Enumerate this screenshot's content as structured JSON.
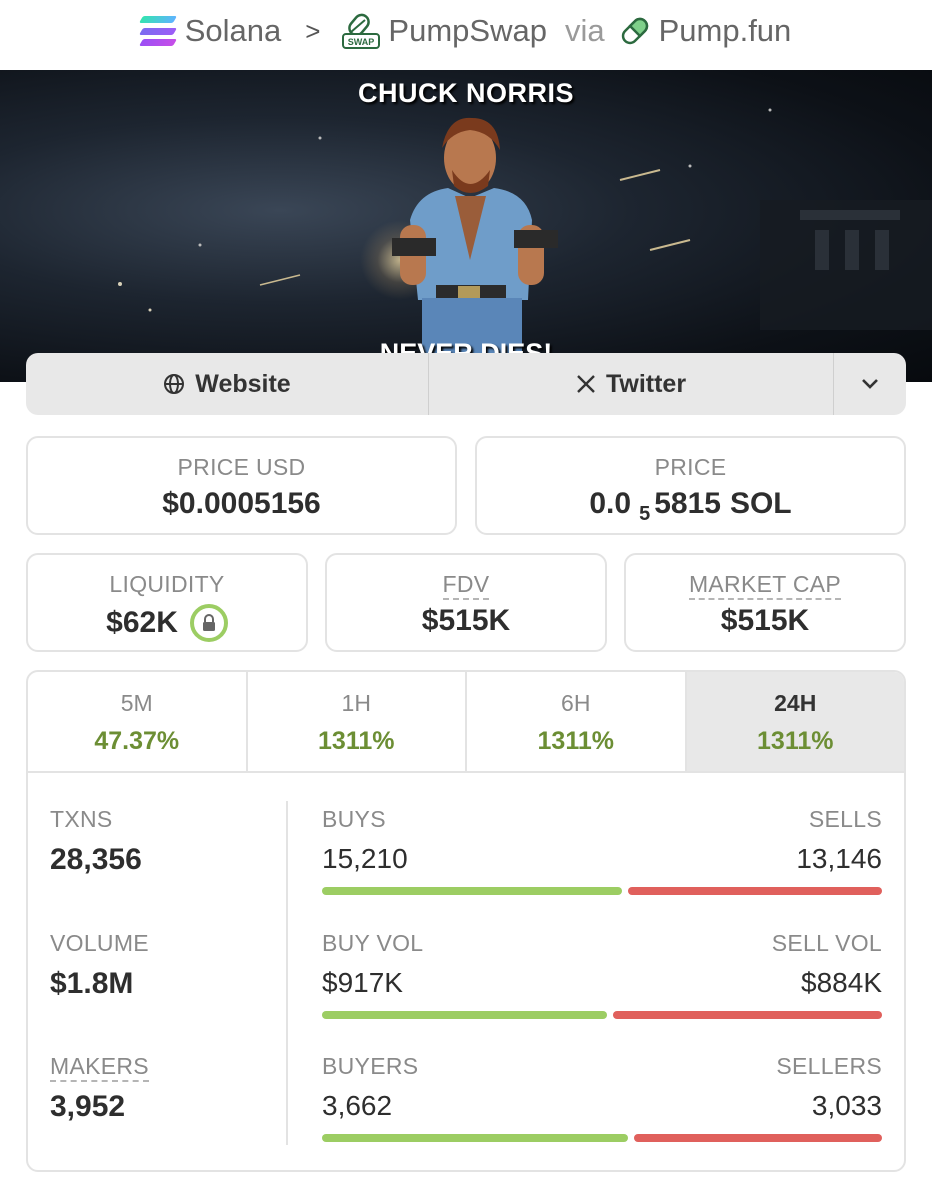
{
  "breadcrumb": {
    "chain": "Solana",
    "separator": ">",
    "dex": "PumpSwap",
    "dex_icon_text": "SWAP",
    "via": "via",
    "launchpad": "Pump.fun"
  },
  "banner": {
    "top_text": "CHUCK NORRIS",
    "bottom_text": "NEVER DIES!"
  },
  "links": {
    "website": "Website",
    "twitter": "Twitter"
  },
  "price": {
    "usd_label": "PRICE USD",
    "usd_value": "$0.0005156",
    "native_label": "PRICE",
    "native_prefix": "0.0",
    "native_zeros": "5",
    "native_digits": "5815",
    "native_unit": "SOL"
  },
  "metrics": {
    "liquidity_label": "LIQUIDITY",
    "liquidity_value": "$62K",
    "fdv_label": "FDV",
    "fdv_value": "$515K",
    "mcap_label": "MARKET CAP",
    "mcap_value": "$515K"
  },
  "timeframes": [
    {
      "label": "5M",
      "change": "47.37%"
    },
    {
      "label": "1H",
      "change": "1311%"
    },
    {
      "label": "6H",
      "change": "1311%"
    },
    {
      "label": "24H",
      "change": "1311%"
    }
  ],
  "selected_timeframe": "24H",
  "stats": {
    "txns_label": "TXNS",
    "txns_value": "28,356",
    "volume_label": "VOLUME",
    "volume_value": "$1.8M",
    "makers_label": "MAKERS",
    "makers_value": "3,952",
    "buys_label": "BUYS",
    "buys_value": "15,210",
    "sells_label": "SELLS",
    "sells_value": "13,146",
    "buy_vol_label": "BUY VOL",
    "buy_vol_value": "$917K",
    "sell_vol_label": "SELL VOL",
    "sell_vol_value": "$884K",
    "buyers_label": "BUYERS",
    "buyers_value": "3,662",
    "sellers_label": "SELLERS",
    "sellers_value": "3,033"
  },
  "bar_ratios": {
    "buys": 0.536,
    "buy_vol": 0.509,
    "buyers": 0.547
  },
  "colors": {
    "positive": "#6c8e34",
    "buy_bar": "#9ccd63",
    "sell_bar": "#e0605c"
  },
  "icons": {
    "chain": "solana-logo-icon",
    "dex": "pumpswap-logo-icon",
    "launchpad": "pill-icon",
    "website": "globe-icon",
    "twitter": "x-logo-icon",
    "more": "chevron-down-icon",
    "liquidity": "lock-icon"
  }
}
